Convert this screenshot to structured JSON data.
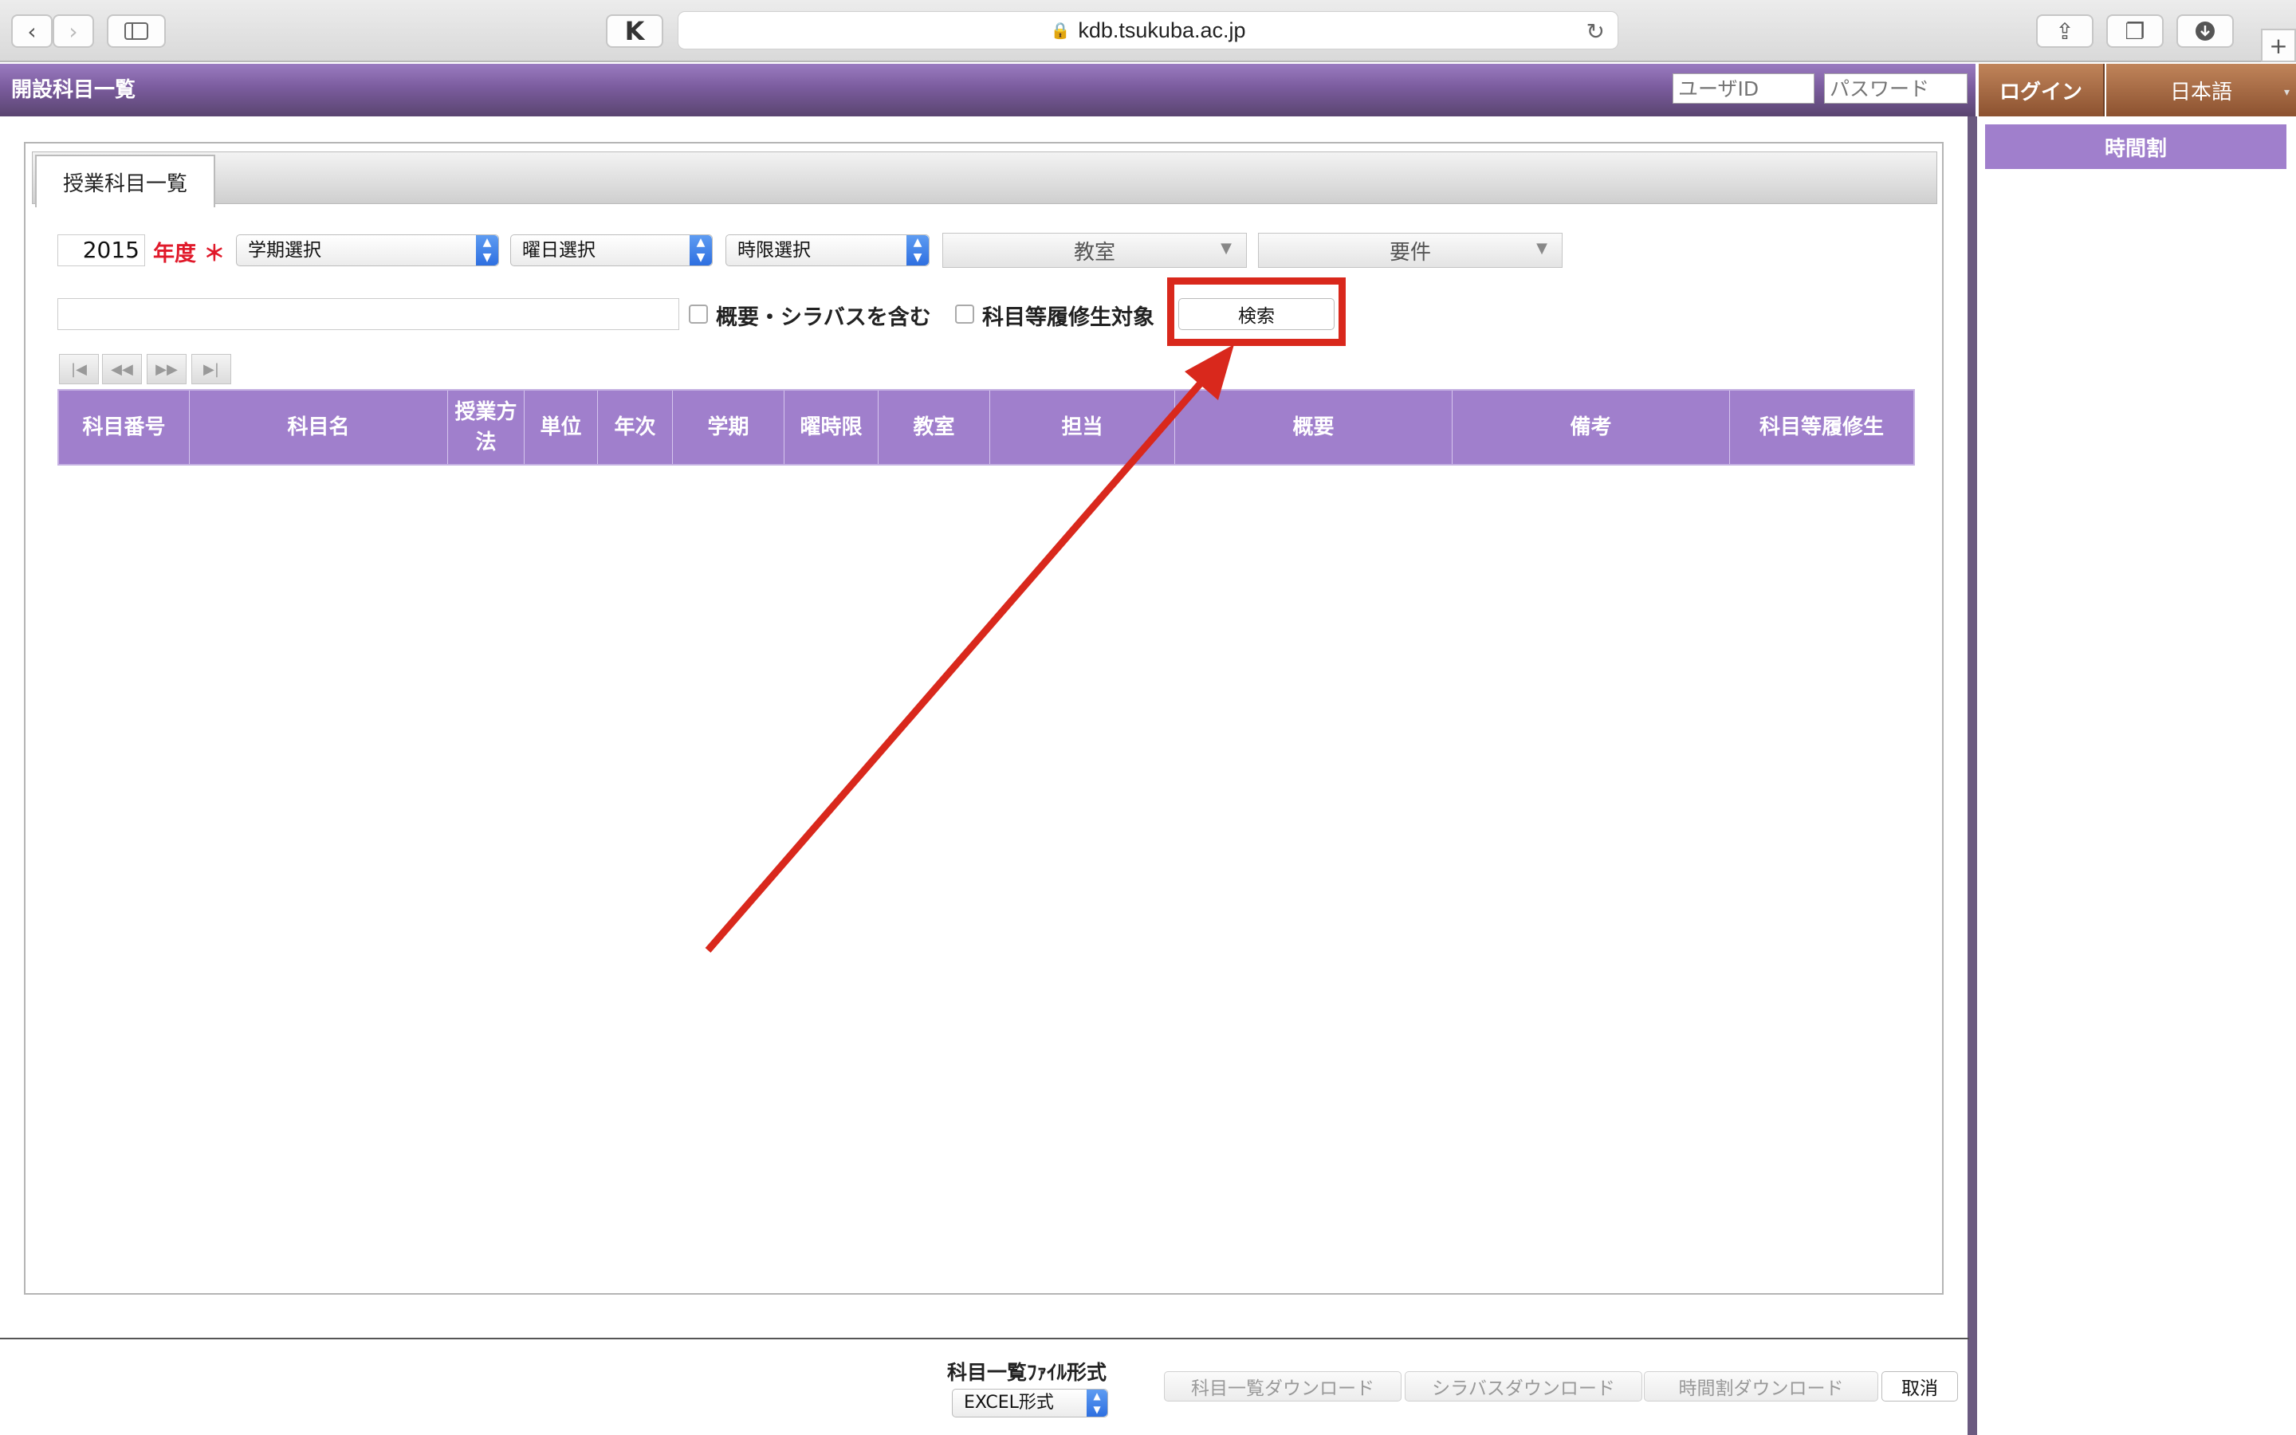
{
  "browser": {
    "url": "kdb.tsukuba.ac.jp",
    "site_icon_letter": "K"
  },
  "header": {
    "title": "開設科目一覧",
    "userid_placeholder": "ユーザID",
    "password_placeholder": "パスワード",
    "login_label": "ログイン",
    "language_label": "日本語"
  },
  "right_panel": {
    "timetable_label": "時間割"
  },
  "main": {
    "tab_label": "授業科目一覧",
    "filters": {
      "year": "2015",
      "year_label": "年度 ＊",
      "term_select": "学期選択",
      "day_select": "曜日選択",
      "period_select": "時限選択",
      "classroom_dropdown": "教室",
      "requirement_dropdown": "要件"
    },
    "search": {
      "keyword_value": "",
      "include_syllabus_label": "概要・シラバスを含む",
      "credit_target_label": "科目等履修生対象",
      "search_button": "検索"
    },
    "pagination": {
      "first": "|◀",
      "prev": "◀◀",
      "next": "▶▶",
      "last": "▶|"
    },
    "table_columns": [
      "科目番号",
      "科目名",
      "授業方法",
      "単位",
      "年次",
      "学期",
      "曜時限",
      "教室",
      "担当",
      "概要",
      "備考",
      "科目等履修生"
    ]
  },
  "footer": {
    "format_label": "科目一覧ﾌｧｲﾙ形式",
    "format_select": "EXCEL形式",
    "list_download": "科目一覧ダウンロード",
    "syllabus_download": "シラバスダウンロード",
    "timetable_download": "時間割ダウンロード",
    "cancel": "取消"
  },
  "annotation": {
    "color": "#d9281c"
  }
}
